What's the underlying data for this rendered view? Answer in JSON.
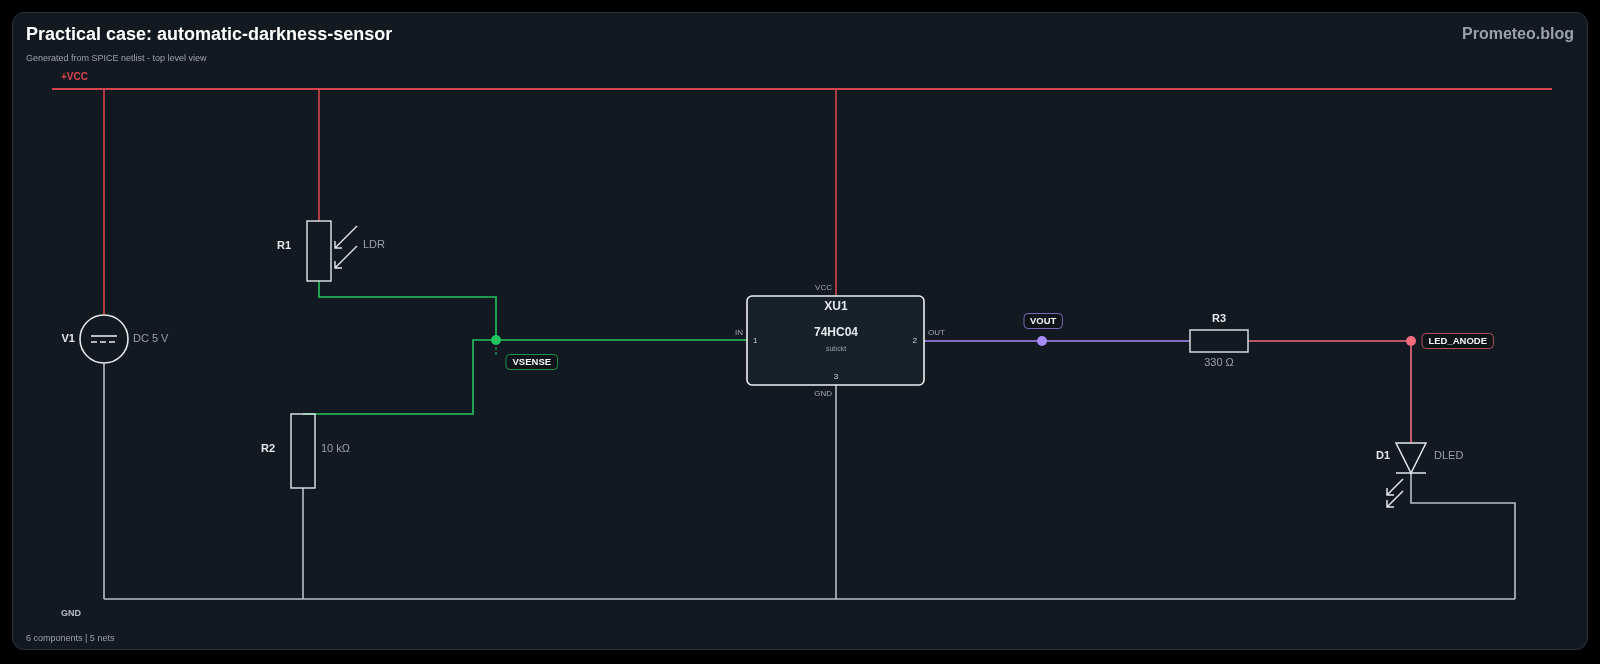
{
  "header": {
    "title": "Practical case: automatic-darkness-sensor",
    "subtitle": "Generated from SPICE netlist - top level view",
    "brand": "Prometeo.blog"
  },
  "components": [
    {
      "kind": "source",
      "ref": "V1",
      "value": "DC 5 V"
    },
    {
      "kind": "ldr",
      "ref": "R1",
      "value": "LDR"
    },
    {
      "kind": "resistor",
      "ref": "R2",
      "value": "10 kΩ"
    },
    {
      "kind": "ic",
      "ref": "XU1",
      "value": "74HC04",
      "subtitle": "subckt",
      "pins": [
        {
          "name": "IN",
          "number": "1"
        },
        {
          "name": "OUT",
          "number": "2"
        },
        {
          "name": "VCC"
        },
        {
          "name": "GND",
          "number": "3"
        }
      ]
    },
    {
      "kind": "resistor",
      "ref": "R3",
      "value": "330 Ω"
    },
    {
      "kind": "led",
      "ref": "D1",
      "value": "DLED"
    }
  ],
  "nets": [
    {
      "kind": "supply",
      "name": "+VCC",
      "color": "#d9444c"
    },
    {
      "kind": "ground",
      "name": "GND",
      "color": "#b9bec6"
    },
    {
      "kind": "node",
      "name": "VSENSE",
      "color": "#22c55e"
    },
    {
      "kind": "node",
      "name": "VOUT",
      "color": "#a78bfa"
    },
    {
      "kind": "node",
      "name": "LED_ANODE",
      "color": "#f26b7f"
    }
  ],
  "footer": "6 components | 5 nets"
}
